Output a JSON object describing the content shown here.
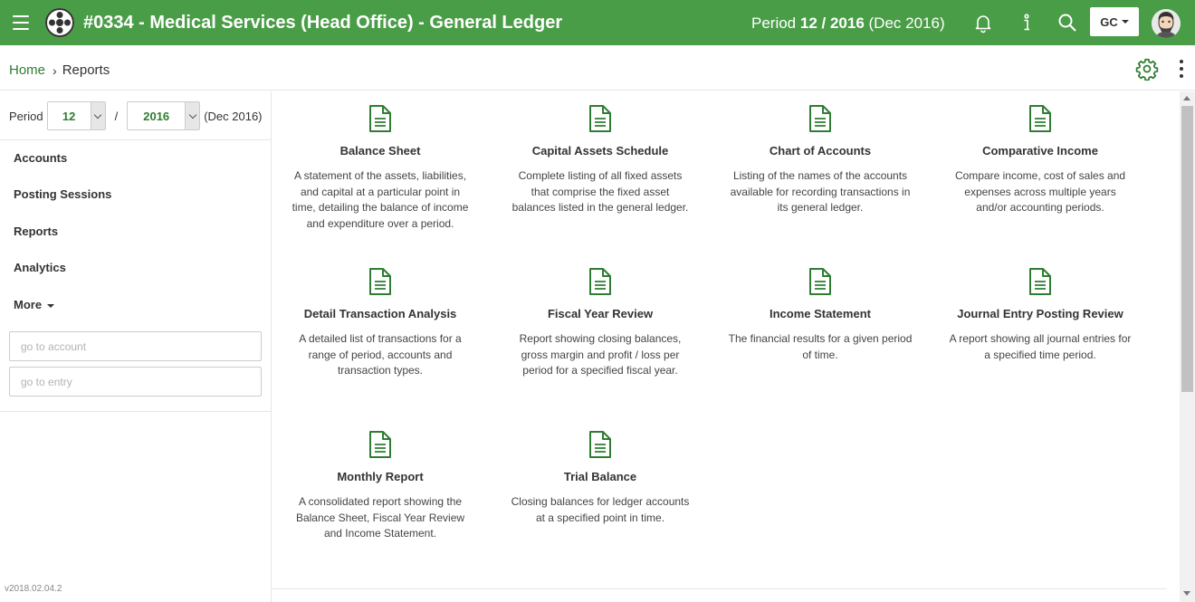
{
  "header": {
    "title": "#0334 - Medical Services (Head Office) - General Ledger",
    "period_prefix": "Period ",
    "period_value": "12 / 2016",
    "period_suffix": " (Dec 2016)",
    "user_initials": "GC",
    "icons": [
      "menu-icon",
      "logo-icon",
      "bell-icon",
      "info-icon",
      "search-icon",
      "avatar"
    ]
  },
  "breadcrumb": {
    "home": "Home",
    "separator": "›",
    "current": "Reports"
  },
  "sidebar": {
    "period_label": "Period",
    "month_value": "12",
    "separator": "/",
    "year_value": "2016",
    "period_hint": "(Dec 2016)",
    "nav": [
      {
        "label": "Accounts"
      },
      {
        "label": "Posting Sessions"
      },
      {
        "label": "Reports"
      },
      {
        "label": "Analytics"
      },
      {
        "label": "More"
      }
    ],
    "goto_account_placeholder": "go to account",
    "goto_entry_placeholder": "go to entry",
    "version": "v2018.02.04.2"
  },
  "reports": [
    {
      "title": "Balance Sheet",
      "description": "A statement of the assets, liabilities, and capital at a particular point in time, detailing the balance of income and expenditure over a period."
    },
    {
      "title": "Capital Assets Schedule",
      "description": "Complete listing of all fixed assets that comprise the fixed asset balances listed in the general ledger."
    },
    {
      "title": "Chart of Accounts",
      "description": "Listing of the names of the accounts available for recording transactions in its general ledger."
    },
    {
      "title": "Comparative Income",
      "description": "Compare income, cost of sales and expenses across multiple years and/or accounting periods."
    },
    {
      "title": "Detail Transaction Analysis",
      "description": "A detailed list of transactions for a range of period, accounts and transaction types."
    },
    {
      "title": "Fiscal Year Review",
      "description": "Report showing closing balances, gross margin and profit / loss per period for a specified fiscal year."
    },
    {
      "title": "Income Statement",
      "description": "The financial results for a given period of time."
    },
    {
      "title": "Journal Entry Posting Review",
      "description": "A report showing all journal entries for a specified time period."
    },
    {
      "title": "Monthly Report",
      "description": "A consolidated report showing the Balance Sheet, Fiscal Year Review and Income Statement."
    },
    {
      "title": "Trial Balance",
      "description": "Closing balances for ledger accounts at a specified point in time."
    }
  ],
  "colors": {
    "brand_green": "#4a9d47",
    "link_green": "#2f7d32",
    "icon_green": "#2f7d32"
  }
}
